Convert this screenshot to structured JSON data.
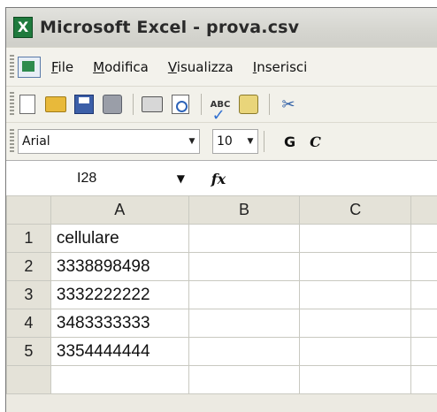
{
  "window": {
    "title": "Microsoft Excel - prova.csv"
  },
  "menu": {
    "items": [
      {
        "label": "File",
        "accel": "F",
        "rest": "ile"
      },
      {
        "label": "Modifica",
        "accel": "M",
        "rest": "odifica"
      },
      {
        "label": "Visualizza",
        "accel": "V",
        "rest": "isualizza"
      },
      {
        "label": "Inserisci",
        "accel": "I",
        "rest": "nserisci"
      }
    ]
  },
  "toolbar": {
    "icons": [
      "new-icon",
      "open-icon",
      "save-icon",
      "permission-icon",
      "print-icon",
      "print-preview-icon",
      "spelling-icon",
      "research-icon",
      "cut-icon"
    ],
    "spell_text": "ABC"
  },
  "format": {
    "font": "Arial",
    "size": "10",
    "bold_label": "G",
    "italic_label": "C"
  },
  "formula_bar": {
    "name_box": "I28",
    "fx_label": "fx",
    "value": ""
  },
  "sheet": {
    "columns": [
      "A",
      "B",
      "C"
    ],
    "rows": [
      {
        "header": "1",
        "cells": [
          "cellulare",
          "",
          ""
        ]
      },
      {
        "header": "2",
        "cells": [
          "3338898498",
          "",
          ""
        ]
      },
      {
        "header": "3",
        "cells": [
          "3332222222",
          "",
          ""
        ]
      },
      {
        "header": "4",
        "cells": [
          "3483333333",
          "",
          ""
        ]
      },
      {
        "header": "5",
        "cells": [
          "3354444444",
          "",
          ""
        ]
      }
    ]
  }
}
